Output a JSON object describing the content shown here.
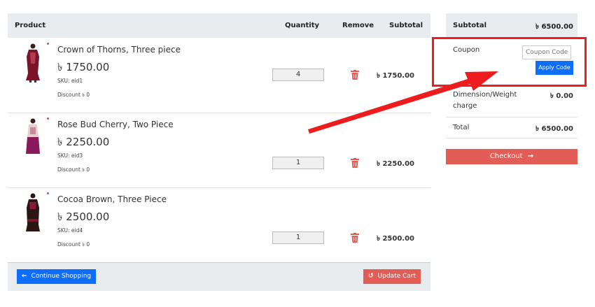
{
  "cart": {
    "headers": {
      "product": "Product",
      "quantity": "Quantity",
      "remove": "Remove",
      "subtotal": "Subtotal"
    },
    "items": [
      {
        "name": "Crown of Thorns, Three piece",
        "price": "৳ 1750.00",
        "sku": "SKU: eid1",
        "discount": "Discount ৳ 0",
        "quantity": "4",
        "subtotal": "৳ 1750.00"
      },
      {
        "name": "Rose Bud Cherry, Two Piece",
        "price": "৳ 2250.00",
        "sku": "SKU: eid3",
        "discount": "Discount ৳ 0",
        "quantity": "1",
        "subtotal": "৳ 2250.00"
      },
      {
        "name": "Cocoa Brown, Three Piece",
        "price": "৳ 2500.00",
        "sku": "SKU: eid4",
        "discount": "Discount ৳ 0",
        "quantity": "1",
        "subtotal": "৳ 2500.00"
      }
    ],
    "continue_label": "Continue Shopping",
    "update_label": "Update Cart"
  },
  "summary": {
    "subtotal_label": "Subtotal",
    "subtotal_value": "৳ 6500.00",
    "coupon_label": "Coupon",
    "coupon_placeholder": "Coupon Code",
    "apply_label": "Apply Code",
    "dimension_label": "Dimension/Weight",
    "dimension_label2": "charge",
    "dimension_value": "৳ 0.00",
    "total_label": "Total",
    "total_value": "৳ 6500.00",
    "checkout_label": "Checkout"
  },
  "colors": {
    "primary": "#0d6efd",
    "danger": "#e35d57",
    "highlight": "#ee1c1c",
    "header_bg": "#e9ecef"
  },
  "icons": [
    "arrow-left-icon",
    "trash-icon",
    "undo-icon",
    "arrow-right-icon",
    "annotation-arrow"
  ]
}
